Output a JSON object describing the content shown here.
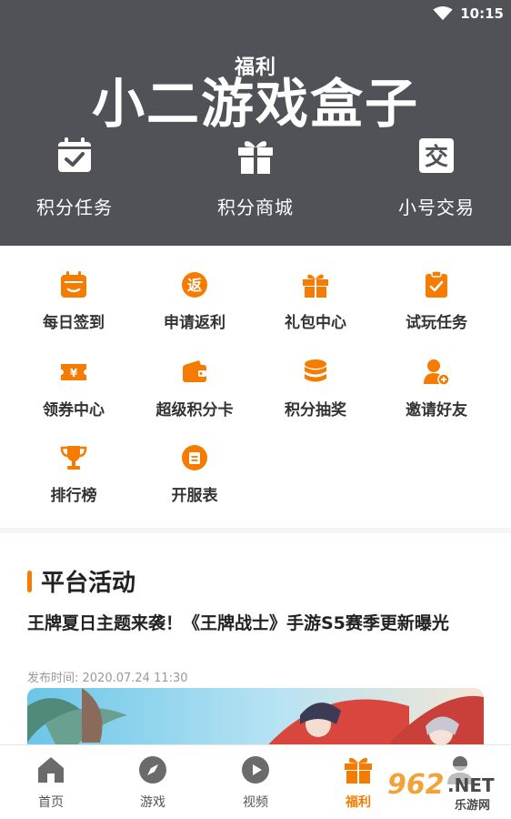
{
  "status": {
    "time": "10:15"
  },
  "header": {
    "subtitle": "福利",
    "title": "小二游戏盒子",
    "actions": [
      {
        "label": "积分任务",
        "icon": "calendar-check-icon"
      },
      {
        "label": "积分商城",
        "icon": "gift-icon"
      },
      {
        "label": "小号交易",
        "icon": "exchange-icon"
      }
    ]
  },
  "grid": {
    "items": [
      {
        "label": "每日签到",
        "icon": "calendar-icon"
      },
      {
        "label": "申请返利",
        "icon": "rebate-icon"
      },
      {
        "label": "礼包中心",
        "icon": "gift-icon"
      },
      {
        "label": "试玩任务",
        "icon": "clipboard-check-icon"
      },
      {
        "label": "领券中心",
        "icon": "ticket-icon"
      },
      {
        "label": "超级积分卡",
        "icon": "wallet-icon"
      },
      {
        "label": "积分抽奖",
        "icon": "coins-icon"
      },
      {
        "label": "邀请好友",
        "icon": "user-add-icon"
      },
      {
        "label": "排行榜",
        "icon": "trophy-icon"
      },
      {
        "label": "开服表",
        "icon": "schedule-icon"
      }
    ]
  },
  "activity": {
    "section_title": "平台活动",
    "news": {
      "title": "王牌夏日主题来袭！《王牌战士》手游S5赛季更新曝光",
      "time": "发布时间: 2020.07.24 11:30"
    }
  },
  "tabbar": {
    "tabs": [
      {
        "label": "首页",
        "icon": "home-icon"
      },
      {
        "label": "游戏",
        "icon": "compass-icon"
      },
      {
        "label": "视频",
        "icon": "play-icon"
      },
      {
        "label": "福利",
        "icon": "gift-icon",
        "active": true
      },
      {
        "label": "",
        "icon": "user-icon"
      }
    ]
  },
  "watermark": {
    "brand": "962",
    "domain": ".NET",
    "sub": "乐游网"
  },
  "colors": {
    "accent": "#f57c00",
    "header_bg": "#505258"
  }
}
